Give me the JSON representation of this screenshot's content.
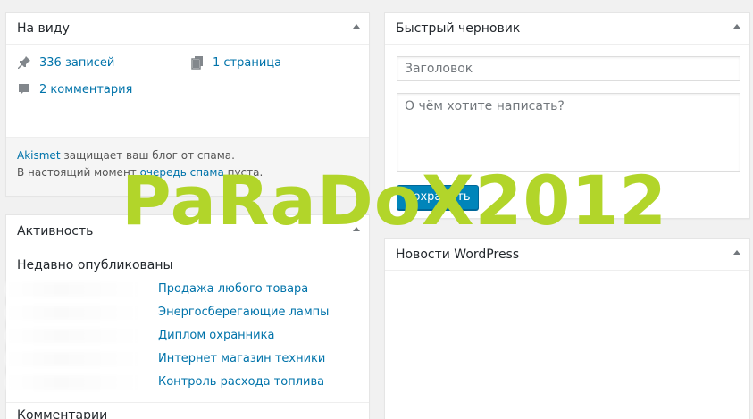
{
  "glance": {
    "title": "На виду",
    "posts": "336 записей",
    "pages": "1 страница",
    "comments": "2 комментария",
    "akismet_link": "Akismet",
    "akismet_text": " защищает ваш блог от спама.",
    "queue_prefix": "В настоящий момент ",
    "queue_link": "очередь спама",
    "queue_suffix": " пуста."
  },
  "activity": {
    "title": "Активность",
    "recent_title": "Недавно опубликованы",
    "posts": [
      "Продажа любого товара",
      "Энергосберегающие лампы",
      "Диплом охранника",
      "Интернет магазин техники",
      "Контроль расхода топлива"
    ],
    "comments_title": "Комментарии"
  },
  "draft": {
    "title": "Быстрый черновик",
    "title_placeholder": "Заголовок",
    "content_placeholder": "О чём хотите написать?",
    "save_label": "Сохранить"
  },
  "news": {
    "title": "Новости WordPress"
  },
  "watermark": "PaRaDoX2012",
  "colors": {
    "link": "#0073aa",
    "primary_button": "#0085ba",
    "watermark": "#b2d52a"
  }
}
